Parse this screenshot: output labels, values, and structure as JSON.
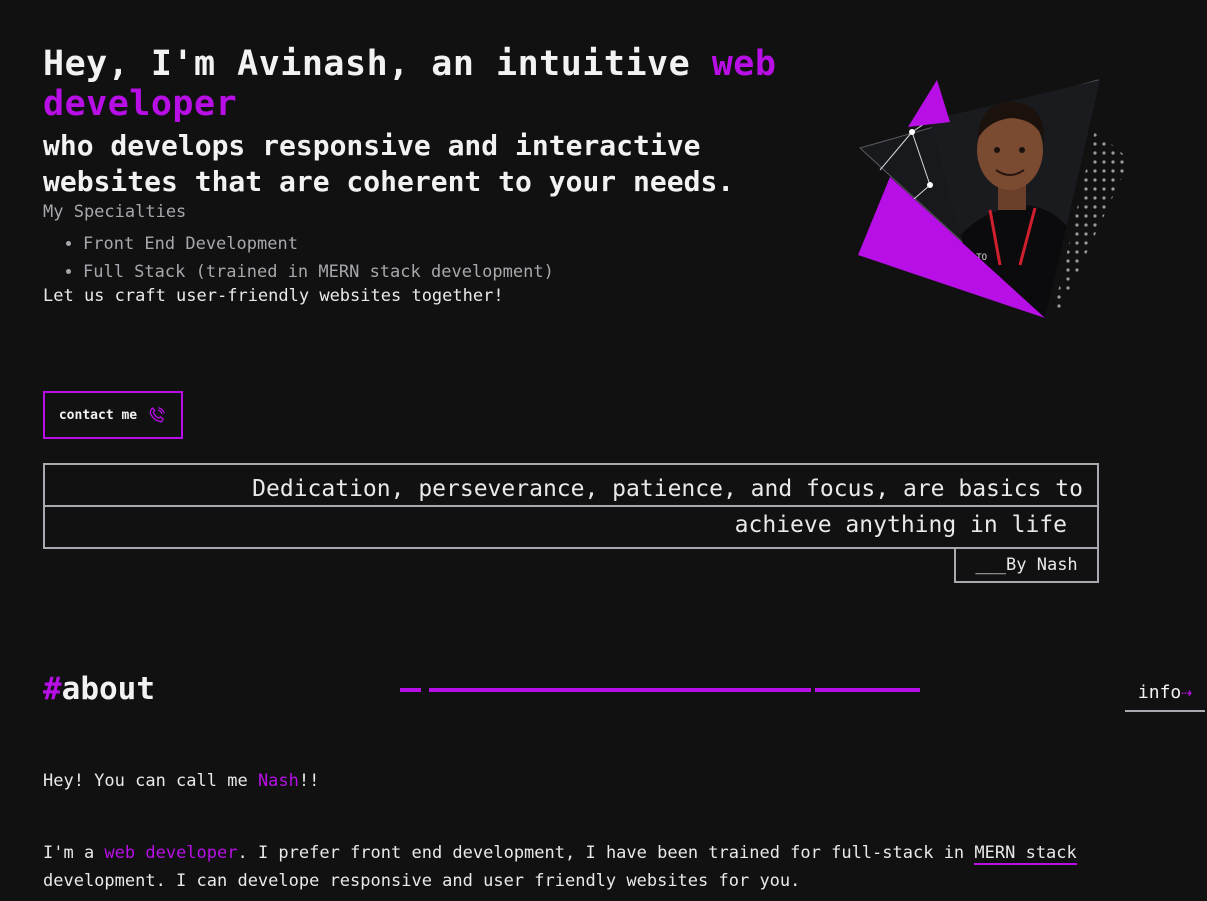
{
  "hero": {
    "title_prefix": "Hey, I'm Avinash, an intuitive ",
    "title_accent": "web developer",
    "subtitle": "who develops responsive and interactive websites that are coherent to your needs.",
    "specialties_heading": "My Specialties",
    "specialties": [
      "Front End Development",
      "Full Stack (trained in MERN stack development)"
    ],
    "tagline": "Let us craft user-friendly websites together!"
  },
  "contact": {
    "label": "contact me",
    "icon": "phone-icon"
  },
  "quote": {
    "line1": "Dedication, perseverance, patience, and focus, are basics to",
    "line2": "achieve anything in life",
    "author": "___By Nash"
  },
  "about": {
    "hash": "#",
    "title": "about",
    "info_label": "info",
    "info_arrow": "⇢",
    "p1_prefix": "Hey! You can call me ",
    "p1_name": "Nash",
    "p1_suffix": "!!",
    "p2_prefix": "I'm a ",
    "p2_accent": "web developer",
    "p2_mid": ". I prefer front end development, I have been trained for full-stack in ",
    "p2_link": "MERN stack",
    "p2_suffix": " development. I can develope responsive and user friendly websites for you."
  },
  "colors": {
    "background": "#111112",
    "accent": "#b80fe6",
    "border": "#a9a9b0"
  }
}
